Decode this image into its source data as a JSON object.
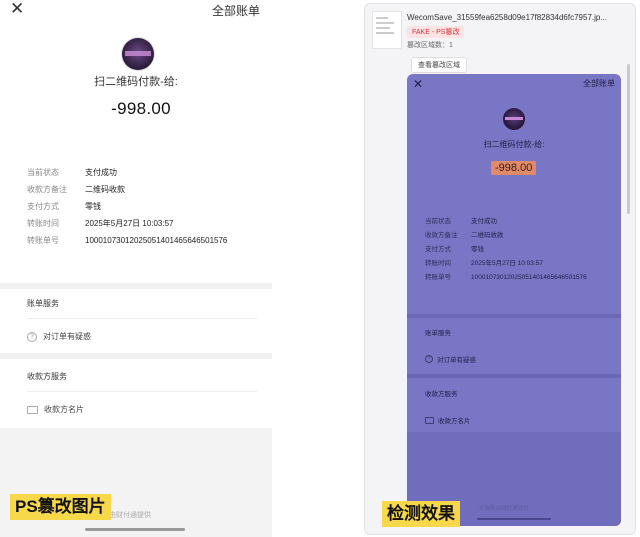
{
  "left_screen": {
    "top_right_link": "全部账单",
    "payee": "扫二维码付款-给:",
    "amount": "-998.00",
    "details": [
      {
        "key": "当前状态",
        "value": "支付成功"
      },
      {
        "key": "收款方备注",
        "value": "二维码收款"
      },
      {
        "key": "支付方式",
        "value": "零钱"
      },
      {
        "key": "转账时间",
        "value": "2025年5月27日 10:03:57"
      },
      {
        "key": "转账单号",
        "value": "10001073012025051401465646501576"
      }
    ],
    "bill_service_title": "账单服务",
    "order_question": "对订单有疑惑",
    "payee_service_title": "收款方服务",
    "payee_card": "收款方名片",
    "footer_note": "服务由财付通提供",
    "overlay_label": "PS篡改图片",
    "icons": {
      "close": "close-icon",
      "question": "question-circle-icon",
      "card": "card-icon"
    }
  },
  "right_panel": {
    "file_name": "WecomSave_31559fea6258d09e17f82834d6fc7957.jp...",
    "fake_badge": "FAKE - PS篡改",
    "region_count": "篡改区域数：1",
    "view_button": "查看篡改区域",
    "overlay_label": "检测效果",
    "highlight_color": "#7a76c6",
    "tamper_color": "#e08a6a",
    "preview": {
      "top_right_link": "全部账单",
      "payee": "扫二维码付款-给:",
      "amount": "-998.00",
      "details": [
        {
          "key": "当前状态",
          "value": "支付成功"
        },
        {
          "key": "收款方备注",
          "value": "二维码收款"
        },
        {
          "key": "支付方式",
          "value": "零钱"
        },
        {
          "key": "转账时间",
          "value": "2025年5月27日 10:03:57"
        },
        {
          "key": "转账单号",
          "value": "10001073012025051401465646501576"
        }
      ],
      "bill_service_title": "账单服务",
      "order_question": "对订单有疑惑",
      "payee_service_title": "收款方服务",
      "payee_card": "收款方名片",
      "footer_note": "本服务由财付通提供"
    }
  }
}
